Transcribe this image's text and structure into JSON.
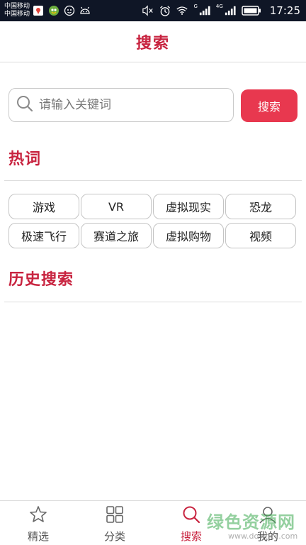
{
  "status_bar": {
    "carriers": [
      "中国移动",
      "中国移动"
    ],
    "net_tags": [
      "G",
      "4G"
    ],
    "time": "17:25"
  },
  "header": {
    "title": "搜索"
  },
  "search": {
    "placeholder": "请输入关键词",
    "value": "",
    "button_label": "搜索"
  },
  "hot": {
    "title": "热词",
    "words": [
      "游戏",
      "VR",
      "虚拟现实",
      "恐龙",
      "极速飞行",
      "赛道之旅",
      "虚拟购物",
      "视频"
    ]
  },
  "history": {
    "title": "历史搜索"
  },
  "nav": {
    "items": [
      {
        "label": "精选",
        "icon": "star-icon",
        "active": false
      },
      {
        "label": "分类",
        "icon": "grid-icon",
        "active": false
      },
      {
        "label": "搜索",
        "icon": "search-icon",
        "active": true
      },
      {
        "label": "我的",
        "icon": "user-icon",
        "active": false
      }
    ]
  },
  "colors": {
    "accent": "#c8233f",
    "button": "#e8384f",
    "statusbar": "#0f1626"
  },
  "watermark": {
    "main": "绿色资源网",
    "sub": "www.downcc.com"
  }
}
